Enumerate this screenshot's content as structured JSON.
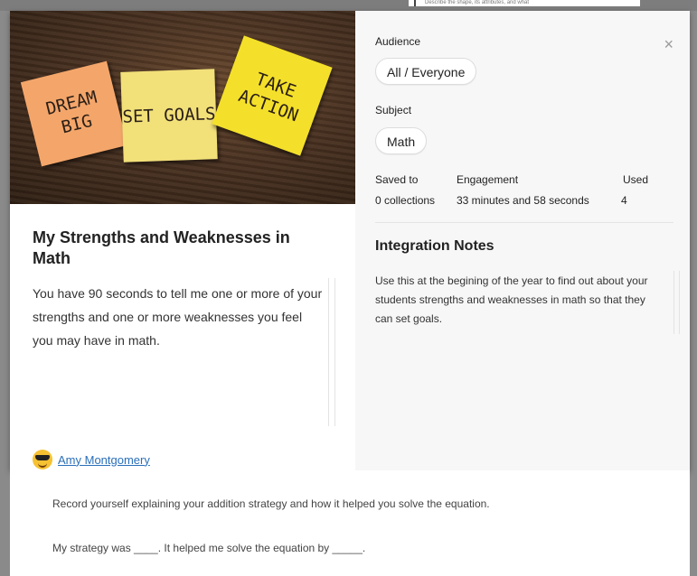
{
  "backdrop": {
    "snippet": "Describe the shape, its attributes, and what"
  },
  "modal": {
    "hero_image": {
      "notes": [
        "DREAM BIG",
        "SET GOALS",
        "TAKE ACTION"
      ]
    },
    "title": "My Strengths and Weaknesses in Math",
    "description": "You have 90 seconds to tell me one or more of your strengths and one or more weaknesses you feel you may have in math.",
    "author": {
      "name": "Amy Montgomery",
      "avatar_icon": "sunglasses-emoji-icon"
    },
    "close_label": "×",
    "audience": {
      "label": "Audience",
      "value": "All / Everyone"
    },
    "subject": {
      "label": "Subject",
      "value": "Math"
    },
    "stats": {
      "saved_to": {
        "label": "Saved to",
        "value": "0 collections"
      },
      "engagement": {
        "label": "Engagement",
        "value": "33 minutes and 58 seconds"
      },
      "used": {
        "label": "Used",
        "value": "4"
      }
    },
    "integration_notes": {
      "title": "Integration Notes",
      "text": "Use this at the begining of the year to find out about your students strengths and weaknesses in math so that they can set goals."
    }
  },
  "background_page": {
    "line1": "Record yourself explaining your addition strategy and how it helped you solve the equation.",
    "line2": "My strategy was ____. It helped me solve the equation by _____."
  },
  "colors": {
    "link": "#2a6fb9",
    "right_panel_bg": "#f7f7f8"
  }
}
